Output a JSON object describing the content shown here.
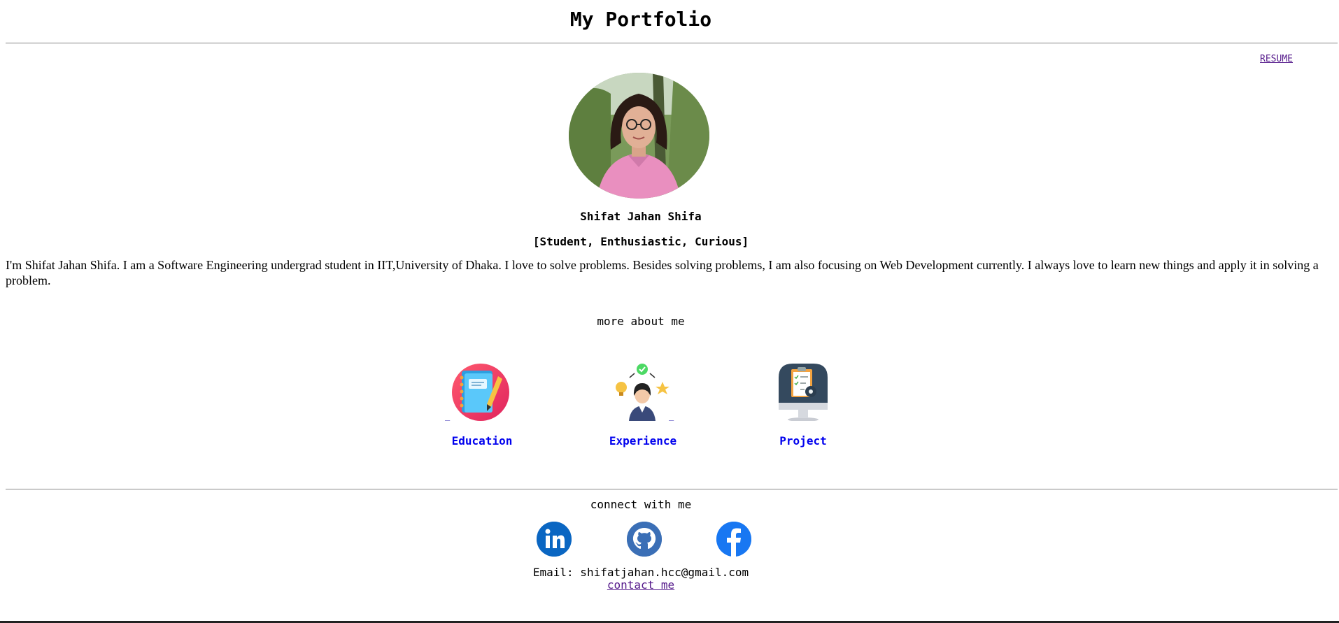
{
  "header": {
    "title": "My Portfolio"
  },
  "nav": {
    "resume_label": "RESUME"
  },
  "profile": {
    "name": "Shifat Jahan Shifa",
    "tagline": "[Student, Enthusiastic, Curious]",
    "bio": "I'm Shifat Jahan Shifa. I am a Software Engineering undergrad student in IIT,University of Dhaka. I love to solve problems. Besides solving problems, I am also focusing on Web Development currently. I always love to learn new things and apply it in solving a problem."
  },
  "more_about": {
    "title": "more about me",
    "sections": [
      {
        "label": "Education",
        "icon": "notebook-icon"
      },
      {
        "label": "Experience",
        "icon": "person-ideas-icon"
      },
      {
        "label": "Project",
        "icon": "monitor-clipboard-icon"
      }
    ],
    "underscore": "_"
  },
  "connect": {
    "title": "connect with me",
    "socials": [
      {
        "icon": "linkedin-icon",
        "color": "#0a66c2"
      },
      {
        "icon": "github-icon",
        "color": "#3b6fb6"
      },
      {
        "icon": "facebook-icon",
        "color": "#1877f2"
      }
    ],
    "email": "Email: shifatjahan.hcc@gmail.com",
    "contact_label": "contact me"
  }
}
